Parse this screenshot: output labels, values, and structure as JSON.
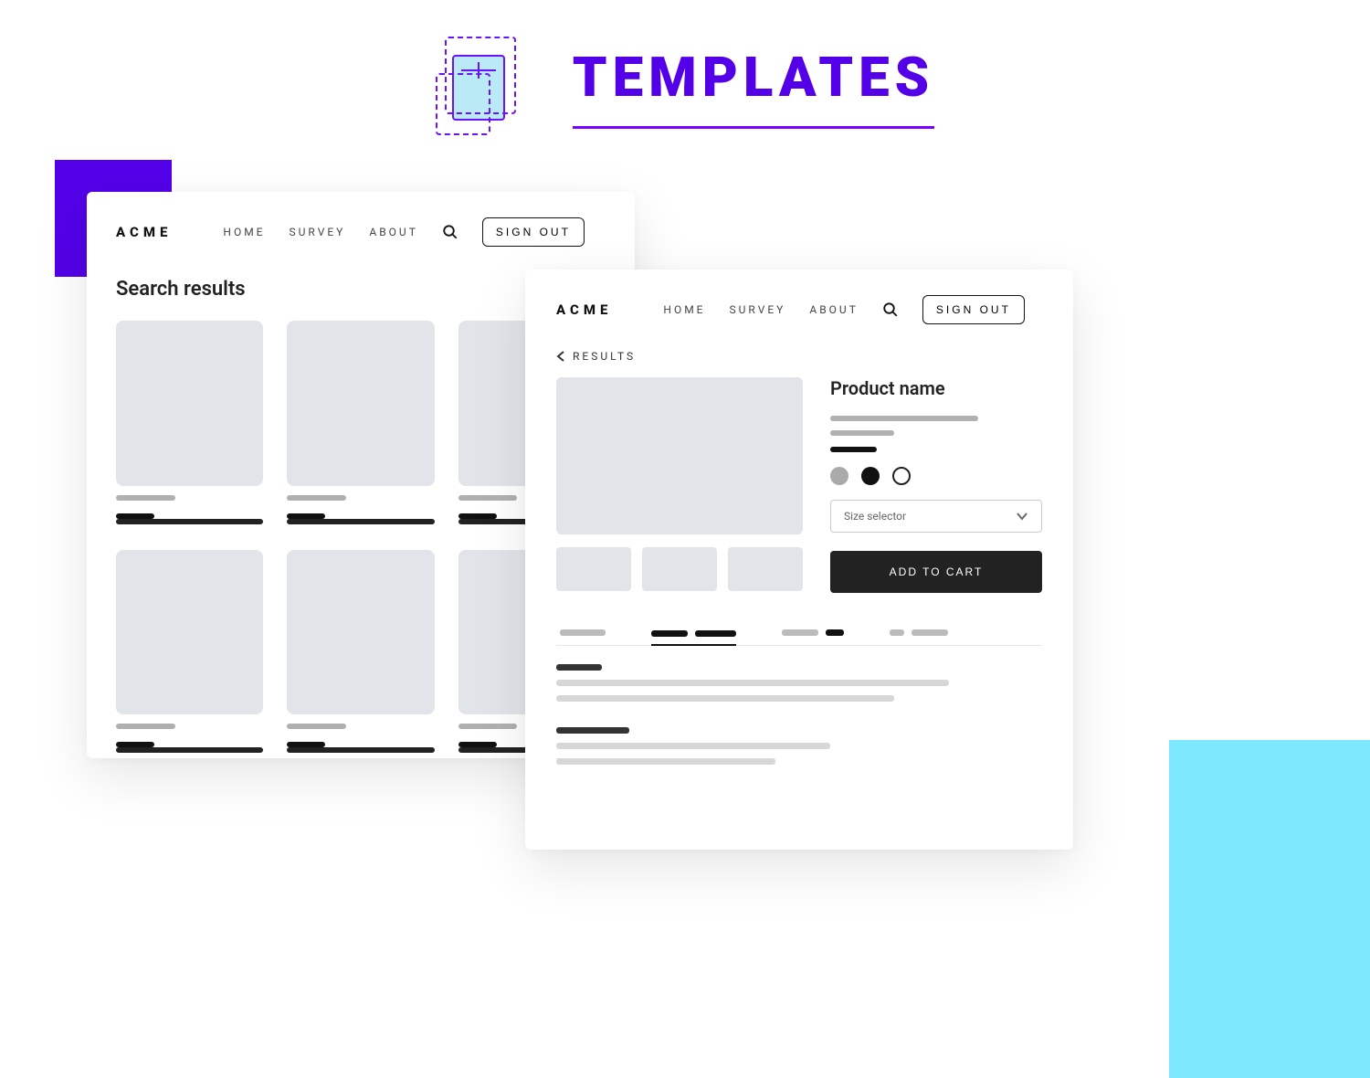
{
  "header": {
    "title": "TEMPLATES"
  },
  "nav": {
    "brand": "ACME",
    "links": [
      "HOME",
      "SURVEY",
      "ABOUT"
    ],
    "signout": "SIGN OUT"
  },
  "card1": {
    "heading": "Search results"
  },
  "card2": {
    "back": "RESULTS",
    "product_title": "Product name",
    "size_selector": "Size selector",
    "add_to_cart": "ADD TO CART"
  }
}
